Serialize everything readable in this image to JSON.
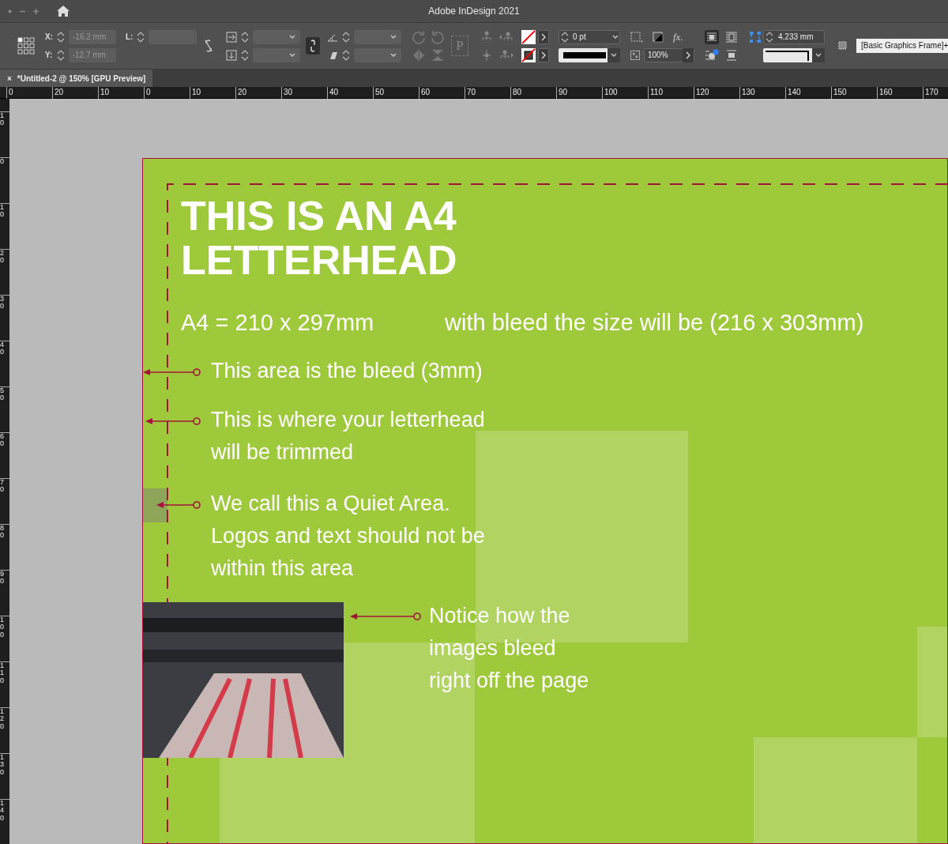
{
  "window": {
    "title": "Adobe InDesign 2021"
  },
  "control_bar": {
    "x_label": "X:",
    "x_value": "-16.2 mm",
    "y_label": "Y:",
    "y_value": "-12.7 mm",
    "l_label": "L:",
    "p_glyph": "P",
    "stroke_weight": "0 pt",
    "fx_glyph": "fx.",
    "opacity": "100%",
    "corner_size": "4.233 mm",
    "object_style": "[Basic Graphics Frame]+"
  },
  "document_tab": {
    "close": "×",
    "title": "*Untitled-2 @ 150% [GPU Preview]",
    "selected": true
  },
  "horizontal_ruler": [
    "0",
    "20",
    "10",
    "0",
    "10",
    "20",
    "30",
    "40",
    "50",
    "60",
    "70",
    "80",
    "90",
    "100",
    "110",
    "120",
    "130",
    "140",
    "150",
    "160",
    "170"
  ],
  "vertical_ruler": [
    "10",
    "0",
    "10",
    "20",
    "30",
    "40",
    "50",
    "60",
    "70",
    "80",
    "90",
    "100",
    "110",
    "120",
    "130",
    "140"
  ],
  "page": {
    "heading": [
      "THIS IS AN A4",
      "LETTERHEAD"
    ],
    "size_text": "A4 = 210 x 297mm",
    "bleed_size_text": "with bleed the size will be (216 x 303mm)",
    "annotations": [
      {
        "kind": "bleed",
        "lines": [
          "This area is the bleed (3mm)"
        ]
      },
      {
        "kind": "trim",
        "lines": [
          "This is where your letterhead",
          "will be trimmed"
        ]
      },
      {
        "kind": "quiet",
        "lines": [
          "We call this a Quiet Area.",
          "Logos and text should not be",
          "within this area"
        ]
      },
      {
        "kind": "image",
        "lines": [
          "Notice how the",
          "images bleed",
          "right off the page"
        ]
      }
    ]
  }
}
